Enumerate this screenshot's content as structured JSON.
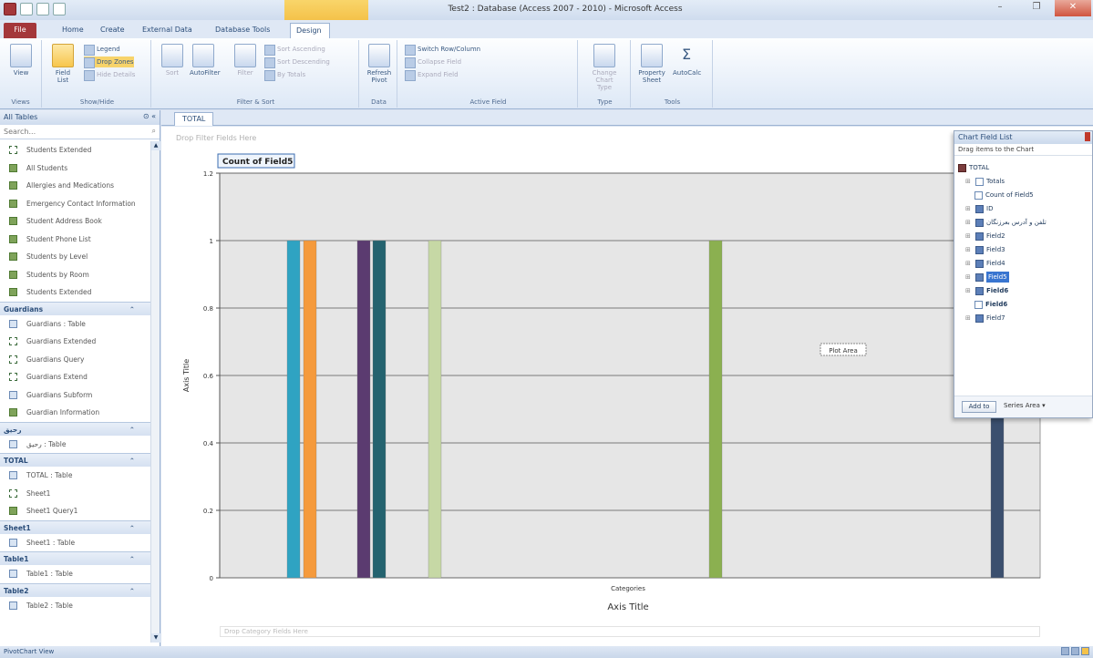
{
  "window": {
    "title": "Test2 : Database (Access 2007 - 2010) - Microsoft Access",
    "min": "–",
    "max": "❐",
    "close": "✕"
  },
  "tabs": {
    "file": "File",
    "home": "Home",
    "create": "Create",
    "external": "External Data",
    "dbtools": "Database Tools",
    "design": "Design"
  },
  "ribbon": {
    "views": {
      "view": "View",
      "label": "Views"
    },
    "showhide": {
      "fieldlist": "Field List",
      "legend": "Legend",
      "dropzones": "Drop Zones",
      "expandcollapse": "Hide Details",
      "label": "Show/Hide"
    },
    "filtersort": {
      "sort": "Sort",
      "autofilter": "AutoFilter",
      "filter": "Filter",
      "sortascending": "Sort Ascending",
      "sortdescending": "Sort Descending",
      "bytotal": "By Totals",
      "label": "Filter & Sort"
    },
    "data": {
      "refresh": "Refresh Pivot",
      "label": "Data"
    },
    "activefield": {
      "switchrowcol": "Switch Row/Column",
      "collapse": "Collapse Field",
      "expand": "Expand Field",
      "label": "Active Field"
    },
    "type": {
      "changetype": "Change Chart Type",
      "label": "Type"
    },
    "tools": {
      "propertysheet": "Property Sheet",
      "autocalc": "AutoCalc",
      "label": "Tools"
    }
  },
  "nav": {
    "header": "All Tables",
    "search_placeholder": "Search...",
    "groups": [
      {
        "title": "",
        "items": [
          {
            "label": "Students Extended",
            "icon": "query"
          },
          {
            "label": "All Students",
            "icon": "form"
          },
          {
            "label": "Allergies and Medications",
            "icon": "form"
          },
          {
            "label": "Emergency Contact Information",
            "icon": "form"
          },
          {
            "label": "Student Address Book",
            "icon": "form"
          },
          {
            "label": "Student Phone List",
            "icon": "form"
          },
          {
            "label": "Students by Level",
            "icon": "form"
          },
          {
            "label": "Students by Room",
            "icon": "form"
          },
          {
            "label": "Students Extended",
            "icon": "form"
          }
        ]
      },
      {
        "title": "Guardians",
        "items": [
          {
            "label": "Guardians : Table",
            "icon": "table"
          },
          {
            "label": "Guardians Extended",
            "icon": "query"
          },
          {
            "label": "Guardians Query",
            "icon": "query"
          },
          {
            "label": "Guardians Extend",
            "icon": "query"
          },
          {
            "label": "Guardians Subform",
            "icon": "table"
          },
          {
            "label": "Guardian Information",
            "icon": "form"
          }
        ]
      },
      {
        "title": "رحيق",
        "items": [
          {
            "label": "رحيق : Table",
            "icon": "table"
          }
        ]
      },
      {
        "title": "TOTAL",
        "items": [
          {
            "label": "TOTAL : Table",
            "icon": "table"
          },
          {
            "label": "Sheet1",
            "icon": "query"
          },
          {
            "label": "Sheet1 Query1",
            "icon": "form"
          }
        ]
      },
      {
        "title": "Sheet1",
        "items": [
          {
            "label": "Sheet1 : Table",
            "icon": "table"
          }
        ]
      },
      {
        "title": "Table1",
        "items": [
          {
            "label": "Table1 : Table",
            "icon": "table"
          }
        ]
      },
      {
        "title": "Table2",
        "items": [
          {
            "label": "Table2 : Table",
            "icon": "table"
          }
        ]
      }
    ]
  },
  "doc": {
    "tab": "TOTAL",
    "filter_zone": "Drop Filter Fields Here",
    "series_zone": "Drop Category Fields Here",
    "plot_area_label": "Plot Area"
  },
  "chart_data": {
    "type": "bar",
    "title": "Count of Field5",
    "ylabel": "Axis Title",
    "xlabel": "Axis Title",
    "categories": [
      "Categories"
    ],
    "ylim": [
      0,
      1.2
    ],
    "yticks": [
      "0",
      "0.2",
      "0.4",
      "0.6",
      "0.8",
      "1",
      "1.2"
    ],
    "grid": true,
    "series": [
      {
        "values": [
          1
        ],
        "color": "#2fa3c2"
      },
      {
        "values": [
          1
        ],
        "color": "#f59a3c"
      },
      {
        "values": [
          1
        ],
        "color": "#5b3b70"
      },
      {
        "values": [
          1
        ],
        "color": "#24636f"
      },
      {
        "values": [
          1
        ],
        "color": "#c6d8a5"
      },
      {
        "values": [
          1
        ],
        "color": "#8bb050"
      },
      {
        "values": [
          1
        ],
        "color": "#3b4f6e"
      }
    ]
  },
  "fieldlist": {
    "title": "Chart Field List",
    "hint": "Drag items to the Chart",
    "items": [
      {
        "label": "TOTAL",
        "kind": "root"
      },
      {
        "label": "Totals",
        "kind": "totals"
      },
      {
        "label": "Count of Field5",
        "kind": "total-item"
      },
      {
        "label": "ID",
        "kind": "field"
      },
      {
        "label": "تلفن و آدرس بعرزنگان",
        "kind": "field"
      },
      {
        "label": "Field2",
        "kind": "field"
      },
      {
        "label": "Field3",
        "kind": "field"
      },
      {
        "label": "Field4",
        "kind": "field"
      },
      {
        "label": "Field5",
        "kind": "field-selected"
      },
      {
        "label": "Field6",
        "kind": "field-bold"
      },
      {
        "label": "Field6",
        "kind": "subfield"
      },
      {
        "label": "Field7",
        "kind": "field"
      }
    ],
    "add_to": "Add to",
    "area": "Series Area"
  },
  "status": {
    "text": "PivotChart View"
  }
}
